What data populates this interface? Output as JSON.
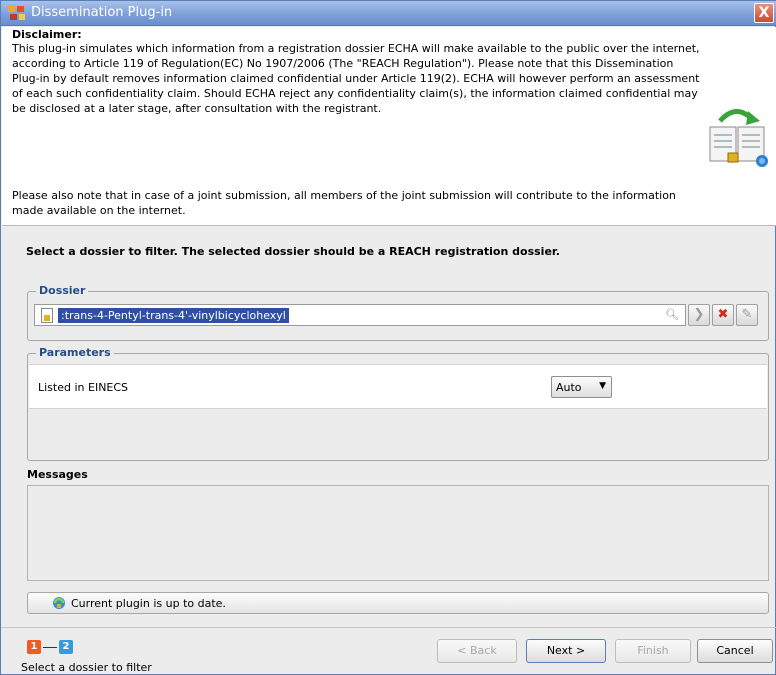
{
  "window": {
    "title": "Dissemination Plug-in",
    "close_glyph": "X"
  },
  "header": {
    "disclaimer_title": "Disclaimer:",
    "disclaimer_text": "This plug-in simulates which information from a registration dossier ECHA will make available to the public over the internet, according to Article 119 of Regulation(EC) No 1907/2006 (The \"REACH Regulation\"). Please note that this Dissemination Plug-in by default removes information claimed confidential under Article 119(2). ECHA will however perform an assessment of each such confidentiality claim. Should ECHA reject any confidentiality claim(s), the information claimed confidential may be disclosed at a later stage, after consultation with the registrant.",
    "joint_text": "Please also note that in case of a joint submission, all members of the joint submission will contribute to the information made available on the internet."
  },
  "instruction": "Select a dossier to filter. The selected dossier should be a REACH registration dossier.",
  "dossier": {
    "group_title": "Dossier",
    "value": ":trans-4-Pentyl-trans-4'-vinylbicyclohexyl"
  },
  "parameters": {
    "group_title": "Parameters",
    "items": [
      {
        "label": "Listed in EINECS",
        "value": "Auto"
      }
    ]
  },
  "messages": {
    "title": "Messages"
  },
  "status": {
    "text": "Current plugin is up to date."
  },
  "wizard": {
    "steps": [
      "1",
      "2"
    ],
    "hint": "Select a dossier to filter"
  },
  "buttons": {
    "back": "< Back",
    "next": "Next >",
    "finish": "Finish",
    "cancel": "Cancel"
  },
  "colors": {
    "titlebar": "#7d9fd8",
    "selection": "#2e4fa3",
    "group_title": "#244e86",
    "step_1": "#f15a24",
    "step_2": "#3a9ad9"
  }
}
